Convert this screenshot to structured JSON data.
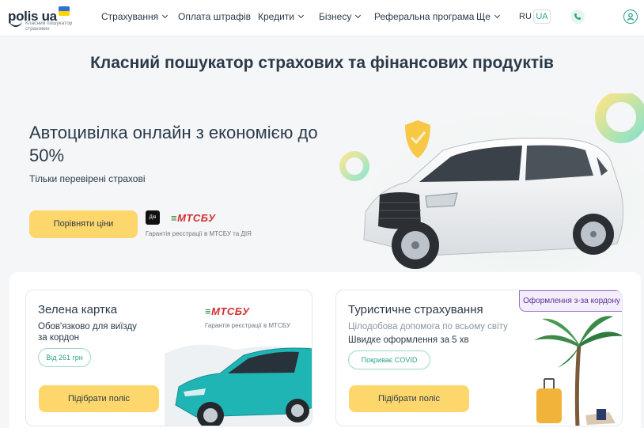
{
  "header": {
    "logo_text": "polis ua",
    "logo_sub": "Класний пошукатор страхових",
    "nav": [
      {
        "label": "Страхування",
        "dropdown": true
      },
      {
        "label": "Оплата штрафів",
        "dropdown": false
      },
      {
        "label": "Кредити",
        "dropdown": true
      },
      {
        "label": "Бізнесу",
        "dropdown": true
      },
      {
        "label": "Реферальна програма",
        "dropdown": false
      },
      {
        "label": "Ще",
        "dropdown": true
      }
    ],
    "lang_ru": "RU",
    "lang_ua": "UA",
    "phone_icon": "phone-icon",
    "user_icon": "user-icon"
  },
  "page_title": "Класний пошукатор страхових та фінансових продуктів",
  "hero": {
    "title": "Автоцивілка онлайн з економією до 50%",
    "subtitle": "Тільки перевірені страхові",
    "button": "Порівняти ціни",
    "diia": "Дія",
    "mtsbu": "МТСБУ",
    "guarantee": "Гарантія реєстрації в МТСБУ та ДІЯ"
  },
  "cards": [
    {
      "title": "Зелена картка",
      "line1": "Обов'язково для виїзду",
      "line2": "за кордон",
      "pill": "Від 261 грн",
      "mtsbu": "МТСБУ",
      "guarantee": "Гарантія реєстрації в МТСБУ",
      "button": "Підібрати поліс"
    },
    {
      "title": "Туристичне страхування",
      "line1": "Цілодобова допомога по всьому світу",
      "line2": "Швидке оформлення за 5 хв",
      "pill": "Покриває COVID",
      "badge": "Оформлення з-за кордону",
      "button": "Підібрати поліс"
    }
  ],
  "colors": {
    "accent_yellow": "#fdd76b",
    "accent_green": "#2aa586",
    "badge_purple": "#9b6fd0"
  }
}
